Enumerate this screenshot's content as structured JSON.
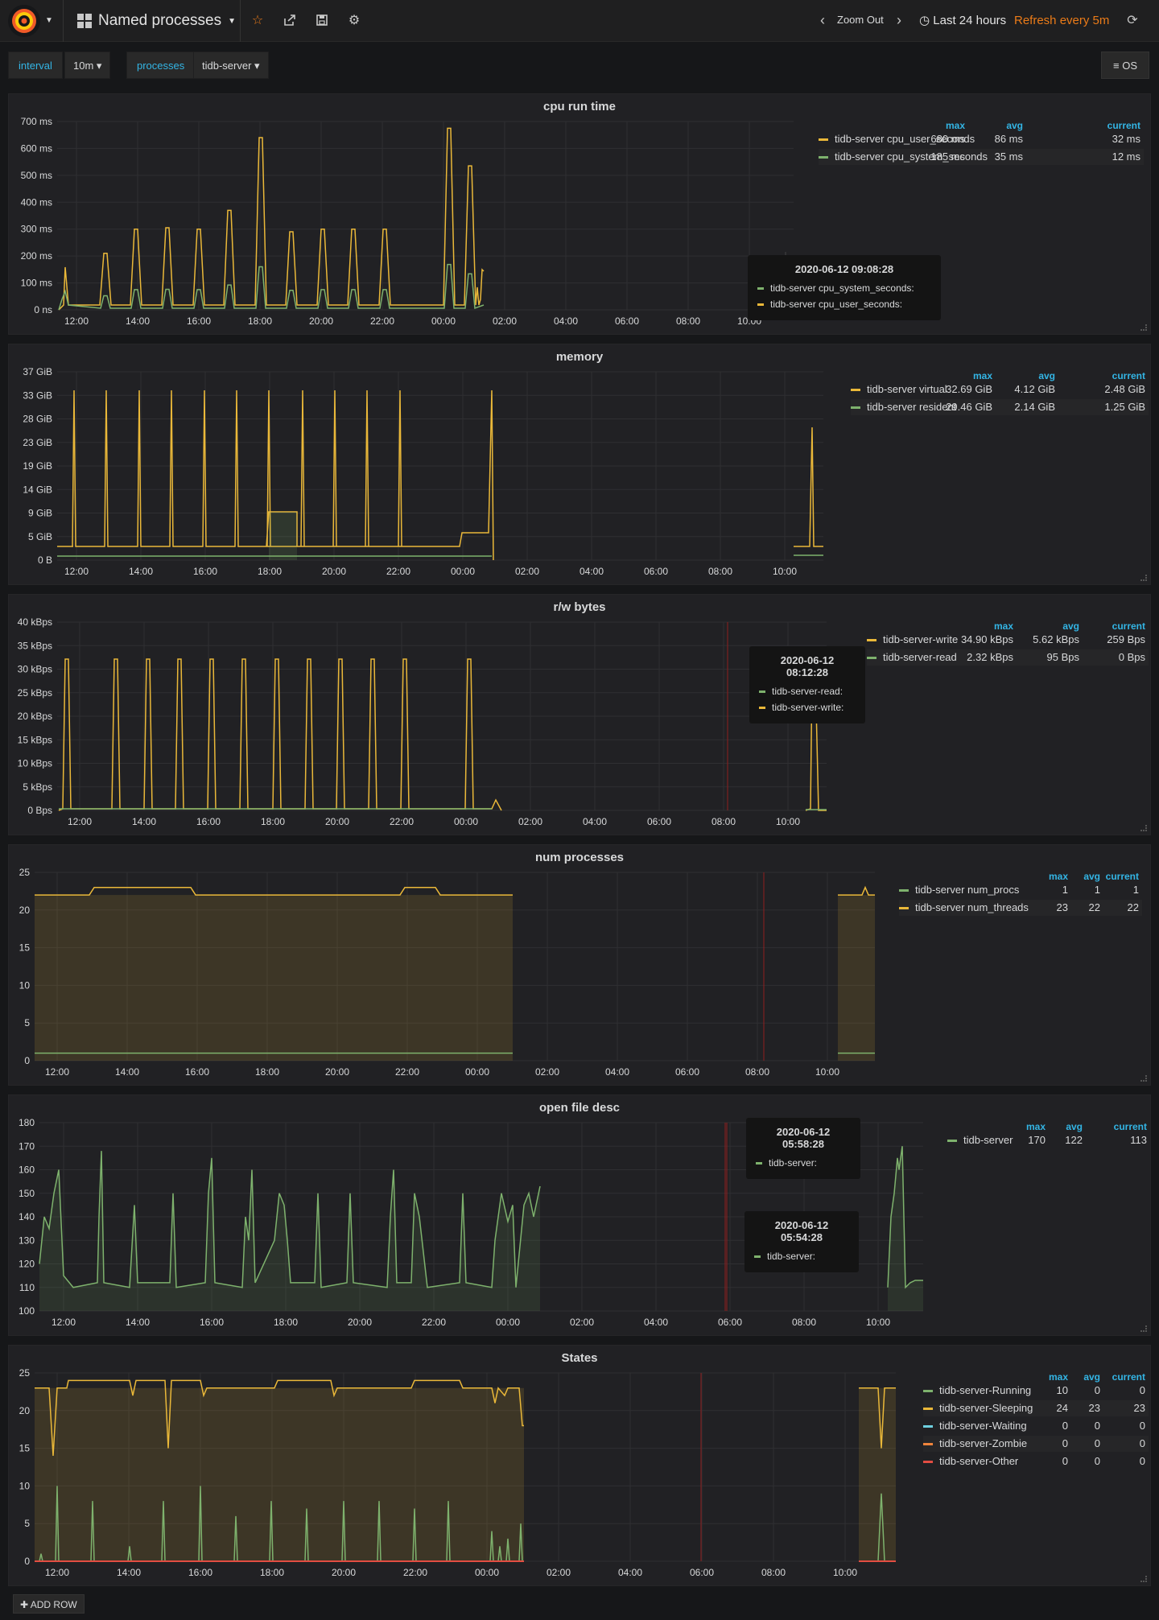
{
  "topbar": {
    "title": "Named processes",
    "icons": [
      "grafana-logo",
      "star-icon",
      "share-icon",
      "save-icon",
      "gear-icon",
      "chevron-left-icon",
      "chevron-right-icon",
      "clock-icon",
      "refresh-icon"
    ],
    "zoom_out": "Zoom Out",
    "time_range": "Last 24 hours",
    "refresh": "Refresh every 5m"
  },
  "templating": {
    "interval_label": "interval",
    "interval_value": "10m",
    "processes_label": "processes",
    "processes_value": "tidb-server",
    "os_label": "OS"
  },
  "x_ticks": [
    "12:00",
    "14:00",
    "16:00",
    "18:00",
    "20:00",
    "22:00",
    "00:00",
    "02:00",
    "04:00",
    "06:00",
    "08:00",
    "10:00"
  ],
  "colors": {
    "yellow": "#eab839",
    "green": "#7eb26d",
    "blue": "#33b5e5",
    "orange": "#ef843c",
    "red": "#e24d42"
  },
  "panels": {
    "cpu": {
      "title": "cpu run time",
      "y_ticks": [
        "0 ns",
        "100 ms",
        "200 ms",
        "300 ms",
        "400 ms",
        "500 ms",
        "600 ms",
        "700 ms"
      ],
      "legend_headers": [
        "max",
        "avg",
        "current"
      ],
      "legend": [
        {
          "name": "tidb-server cpu_user_seconds",
          "max": "680 ms",
          "avg": "86 ms",
          "current": "32 ms",
          "color": "#eab839"
        },
        {
          "name": "tidb-server cpu_system_seconds",
          "max": "185 ms",
          "avg": "35 ms",
          "current": "12 ms",
          "color": "#7eb26d"
        }
      ],
      "tooltip": {
        "time": "2020-06-12 09:08:28",
        "rows": [
          "tidb-server cpu_system_seconds:",
          "tidb-server cpu_user_seconds:"
        ]
      }
    },
    "memory": {
      "title": "memory",
      "y_ticks": [
        "0 B",
        "5 GiB",
        "9 GiB",
        "14 GiB",
        "19 GiB",
        "23 GiB",
        "28 GiB",
        "33 GiB",
        "37 GiB"
      ],
      "legend_headers": [
        "max",
        "avg",
        "current"
      ],
      "legend": [
        {
          "name": "tidb-server virtual",
          "max": "32.69 GiB",
          "avg": "4.12 GiB",
          "current": "2.48 GiB",
          "color": "#eab839"
        },
        {
          "name": "tidb-server resident",
          "max": "29.46 GiB",
          "avg": "2.14 GiB",
          "current": "1.25 GiB",
          "color": "#7eb26d"
        }
      ]
    },
    "rw": {
      "title": "r/w bytes",
      "y_ticks": [
        "0 Bps",
        "5 kBps",
        "10 kBps",
        "15 kBps",
        "20 kBps",
        "25 kBps",
        "30 kBps",
        "35 kBps",
        "40 kBps"
      ],
      "legend_headers": [
        "max",
        "avg",
        "current"
      ],
      "legend": [
        {
          "name": "tidb-server-write",
          "max": "34.90 kBps",
          "avg": "5.62 kBps",
          "current": "259 Bps",
          "color": "#eab839"
        },
        {
          "name": "tidb-server-read",
          "max": "2.32 kBps",
          "avg": "95 Bps",
          "current": "0 Bps",
          "color": "#7eb26d"
        }
      ],
      "tooltip": {
        "time": "2020-06-12 08:12:28",
        "rows": [
          "tidb-server-read:",
          "tidb-server-write:"
        ]
      }
    },
    "procs": {
      "title": "num processes",
      "y_ticks": [
        "0",
        "5",
        "10",
        "15",
        "20",
        "25"
      ],
      "legend_headers": [
        "max",
        "avg",
        "current"
      ],
      "legend": [
        {
          "name": "tidb-server num_procs",
          "max": "1",
          "avg": "1",
          "current": "1",
          "color": "#7eb26d"
        },
        {
          "name": "tidb-server num_threads",
          "max": "23",
          "avg": "22",
          "current": "22",
          "color": "#eab839"
        }
      ]
    },
    "fd": {
      "title": "open file desc",
      "y_ticks": [
        "100",
        "110",
        "120",
        "130",
        "140",
        "150",
        "160",
        "170",
        "180"
      ],
      "legend_headers": [
        "max",
        "avg",
        "current"
      ],
      "legend": [
        {
          "name": "tidb-server",
          "max": "170",
          "avg": "122",
          "current": "113",
          "color": "#7eb26d"
        }
      ],
      "tooltip1": {
        "time": "2020-06-12 05:58:28",
        "rows": [
          "tidb-server:"
        ]
      },
      "tooltip2": {
        "time": "2020-06-12 05:54:28",
        "rows": [
          "tidb-server:"
        ]
      }
    },
    "states": {
      "title": "States",
      "y_ticks": [
        "0",
        "5",
        "10",
        "15",
        "20",
        "25"
      ],
      "legend_headers": [
        "max",
        "avg",
        "current"
      ],
      "legend": [
        {
          "name": "tidb-server-Running",
          "max": "10",
          "avg": "0",
          "current": "0",
          "color": "#7eb26d"
        },
        {
          "name": "tidb-server-Sleeping",
          "max": "24",
          "avg": "23",
          "current": "23",
          "color": "#eab839"
        },
        {
          "name": "tidb-server-Waiting",
          "max": "0",
          "avg": "0",
          "current": "0",
          "color": "#6ed0e0"
        },
        {
          "name": "tidb-server-Zombie",
          "max": "0",
          "avg": "0",
          "current": "0",
          "color": "#ef843c"
        },
        {
          "name": "tidb-server-Other",
          "max": "0",
          "avg": "0",
          "current": "0",
          "color": "#e24d42"
        }
      ]
    }
  },
  "add_row": "ADD ROW"
}
